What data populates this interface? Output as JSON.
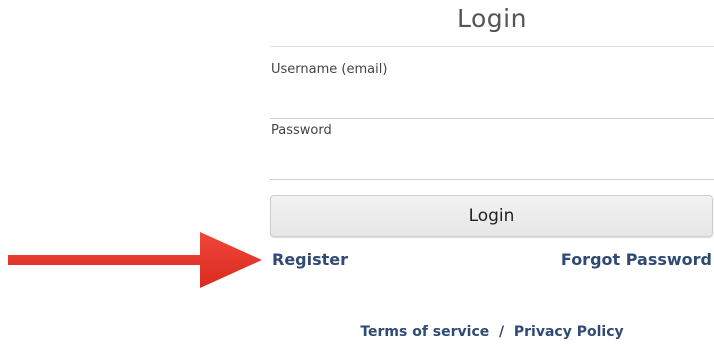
{
  "login_form": {
    "title": "Login",
    "username_label": "Username (email)",
    "username_value": "",
    "password_label": "Password",
    "password_value": "",
    "login_button_label": "Login",
    "register_link": "Register",
    "forgot_password_link": "Forgot Password"
  },
  "footer": {
    "terms_link": "Terms of service",
    "separator": "/",
    "privacy_link": "Privacy Policy"
  },
  "annotation": {
    "arrow_color": "#e8372b"
  },
  "colors": {
    "link": "#2f4a73",
    "button_background": "#ececec"
  }
}
